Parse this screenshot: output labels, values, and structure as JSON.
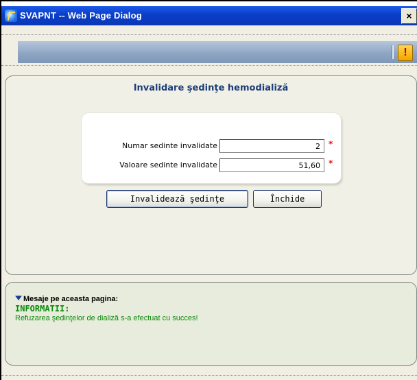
{
  "window": {
    "title": "SVAPNT -- Web Page Dialog",
    "close_glyph": "×"
  },
  "toolbar": {
    "warning_glyph": "!"
  },
  "form": {
    "title": "Invalidare şedinţe hemodializă",
    "fields": [
      {
        "label": "Numar sedinte invalidate",
        "value": "2",
        "required_mark": "*"
      },
      {
        "label": "Valoare sedinte invalidate",
        "value": "51,60",
        "required_mark": "*"
      }
    ],
    "buttons": {
      "invalidate_label": "Invalidează şedinţe",
      "close_label": "Închide"
    }
  },
  "messages": {
    "header": "Mesaje pe aceasta pagina:",
    "type": "INFORMATII:",
    "text": "Refuzarea şedinţelor de dializă s-a efectuat cu succes!"
  },
  "colors": {
    "titlebar": "#0a3ec8",
    "title_text": "#1c3d78",
    "required": "#e01010",
    "info_text": "#0a8a0a"
  }
}
